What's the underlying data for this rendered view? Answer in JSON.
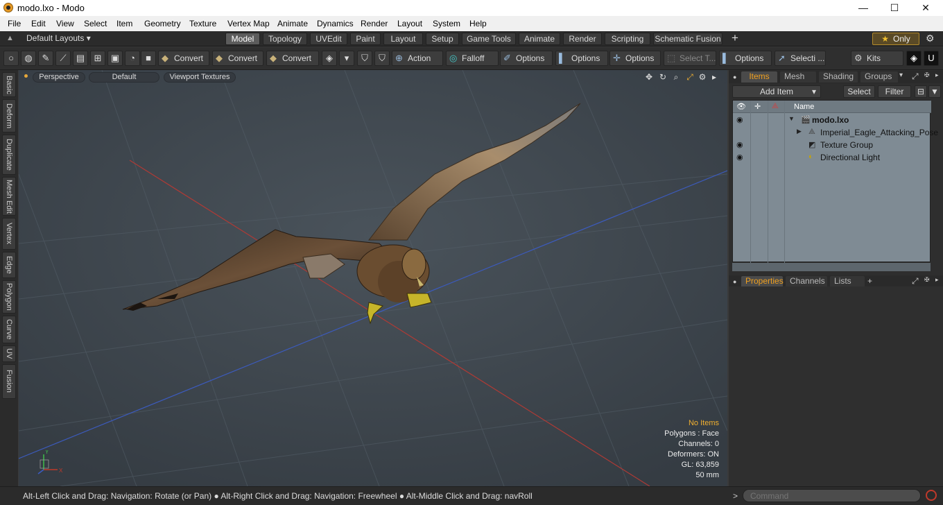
{
  "window": {
    "title": "modo.lxo - Modo",
    "minimize": "—",
    "maximize": "☐",
    "close": "✕"
  },
  "menu": [
    "File",
    "Edit",
    "View",
    "Select",
    "Item",
    "Geometry",
    "Texture",
    "Vertex Map",
    "Animate",
    "Dynamics",
    "Render",
    "Layout",
    "System",
    "Help"
  ],
  "layoutbar": {
    "layouts_label": "Default Layouts ▾",
    "tabs": [
      "Model",
      "Topology",
      "UVEdit",
      "Paint",
      "Layout",
      "Setup",
      "Game Tools",
      "Animate",
      "Render",
      "Scripting",
      "Schematic Fusion"
    ],
    "active_tab": "Model",
    "add_tab": "+",
    "only_label": "Only",
    "only_star": "★",
    "settings": "⚙"
  },
  "toolbar": {
    "convert_1": "Convert",
    "convert_2": "Convert",
    "convert_3": "Convert",
    "action": "Action",
    "falloff": "Falloff",
    "options_1": "Options",
    "options_2": "Options",
    "options_3": "Options",
    "select_t": "Select T...",
    "options_4": "Options",
    "selecti": "Selecti ...",
    "kits": "Kits"
  },
  "left_tabs": [
    "Basic",
    "Deform",
    "Duplicate",
    "Mesh Edit",
    "Vertex",
    "Edge",
    "Polygon",
    "Curve",
    "UV",
    "Fusion"
  ],
  "viewport": {
    "view_type": "Perspective",
    "shading": "Default",
    "textures": "Viewport Textures",
    "hud": {
      "selection": "No Items",
      "polygons": "Polygons : Face",
      "channels": "Channels: 0",
      "deformers": "Deformers: ON",
      "gl": "GL: 63,859",
      "lens": "50 mm"
    },
    "axis_labels": {
      "x": "X",
      "y": "Y",
      "z": "Z"
    }
  },
  "items_panel": {
    "tabs": [
      "Items",
      "Mesh ...",
      "Shading",
      "Groups"
    ],
    "active_tab": "Items",
    "add_item": "Add Item",
    "select": "Select",
    "filter": "Filter",
    "column_name": "Name",
    "tree": [
      {
        "label": "modo.lxo",
        "bold": true
      },
      {
        "label": "Imperial_Eagle_Attacking_Pose"
      },
      {
        "label": "Texture Group"
      },
      {
        "label": "Directional Light"
      }
    ]
  },
  "properties_panel": {
    "tabs": [
      "Properties",
      "Channels",
      "Lists"
    ],
    "active_tab": "Properties",
    "add_tab": "+"
  },
  "statusbar": {
    "hint": "Alt-Left Click and Drag: Navigation: Rotate (or Pan) ● Alt-Right Click and Drag: Navigation: Freewheel ● Alt-Middle Click and Drag: navRoll",
    "prompt": ">",
    "command_placeholder": "Command"
  },
  "colors": {
    "accent": "#f0a020",
    "viewport_bg": "#424a52",
    "x_axis": "#c0392b",
    "z_axis": "#3b5cc4"
  }
}
